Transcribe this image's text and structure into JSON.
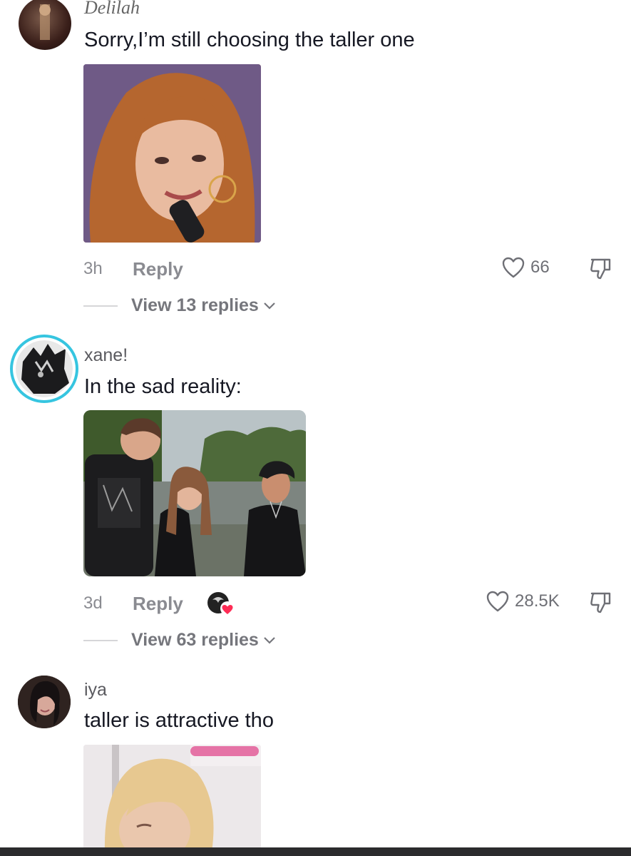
{
  "comments": [
    {
      "username": "Delilah",
      "text": "Sorry,I’m still choosing the taller one",
      "time": "3h",
      "reply_label": "Reply",
      "likes": "66",
      "view_replies": "View 13 replies"
    },
    {
      "username": "xane!",
      "text": "In the sad reality:",
      "time": "3d",
      "reply_label": "Reply",
      "likes": "28.5K",
      "view_replies": "View 63 replies"
    },
    {
      "username": "iya",
      "text": "taller is attractive tho"
    }
  ],
  "icons": {
    "like": "heart-outline-icon",
    "dislike": "thumbs-down-outline-icon",
    "chevron": "chevron-down-icon",
    "creator_liked": "creator-liked-badge"
  },
  "colors": {
    "text_primary": "#161823",
    "text_secondary": "#8a8b91",
    "story_ring": "#36c5e0",
    "heart_badge": "#fe2c55"
  }
}
